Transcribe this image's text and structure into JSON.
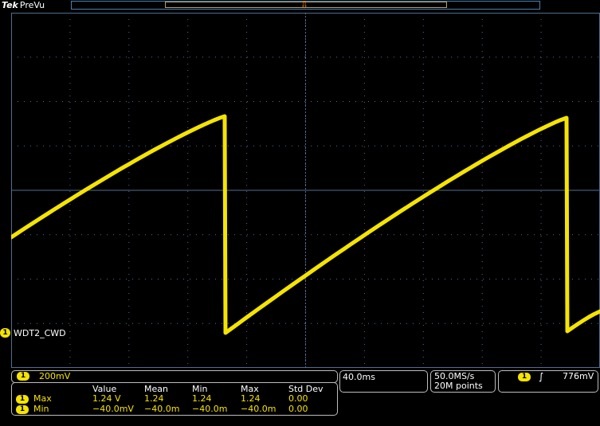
{
  "header": {
    "brand": "Tek",
    "mode": "PreVu"
  },
  "waveform": {
    "channel_badge": "1",
    "label": "WDT2_CWD",
    "trace_color": "#f5e400",
    "grid_color": "#4f6f8f"
  },
  "channel_panel": {
    "badge": "1",
    "scale": "200mV"
  },
  "measurements": {
    "headers": [
      "Value",
      "Mean",
      "Min",
      "Max",
      "Std Dev"
    ],
    "rows": [
      {
        "badge": "1",
        "name": "Max",
        "cells": [
          "1.24 V",
          "1.24",
          "1.24",
          "1.24",
          "0.00"
        ]
      },
      {
        "badge": "1",
        "name": "Min",
        "cells": [
          "−40.0mV",
          "−40.0m",
          "−40.0m",
          "−40.0m",
          "0.00"
        ]
      }
    ]
  },
  "timebase": {
    "scale": "40.0ms"
  },
  "acquisition": {
    "rate": "50.0MS/s",
    "points": "20M points"
  },
  "trigger": {
    "badge": "1",
    "slope_icon": "rising-edge-icon",
    "level": "776mV"
  }
}
